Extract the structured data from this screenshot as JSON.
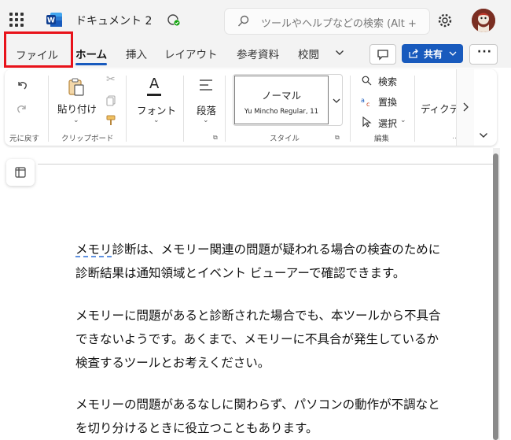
{
  "titlebar": {
    "doc_title": "ドキュメント 2",
    "search_placeholder": "ツールやヘルプなどの検索 (Alt +"
  },
  "tabs": [
    "ファイル",
    "ホーム",
    "挿入",
    "レイアウト",
    "参考資料",
    "校閲"
  ],
  "active_tab": "ホーム",
  "share_label": "共有",
  "ribbon": {
    "undo_group": "元に戻す",
    "paste_label": "貼り付け",
    "clipboard_group": "クリップボード",
    "font_label": "フォント",
    "paragraph_label": "段落",
    "style_name": "ノーマル",
    "style_font": "Yu Mincho Regular, 11",
    "style_group": "スタイル",
    "find_label": "検索",
    "replace_label": "置換",
    "select_label": "選択",
    "edit_group": "編集",
    "dictate_label": "ディクテ"
  },
  "document": {
    "p1_l1_word": "メモリ",
    "p1_l1_rest": "診断は、メモリー関連の問題が疑われる場合の検査のために",
    "p1_l2": "診断結果は通知領域とイベント ビューアーで確認できます。",
    "p2_l1": "メモリーに問題があると診断された場合でも、本ツールから不具合",
    "p2_l2": "できないようです。あくまで、メモリーに不具合が発生しているか",
    "p2_l3": "検査するツールとお考えください。",
    "p3_l1": "メモリーの問題があるなしに関わらず、パソコンの動作が不調なと",
    "p3_l2": "を切り分けるときに役立つこともあります。"
  },
  "colors": {
    "accent": "#185abd",
    "highlight": "#e8121a"
  }
}
